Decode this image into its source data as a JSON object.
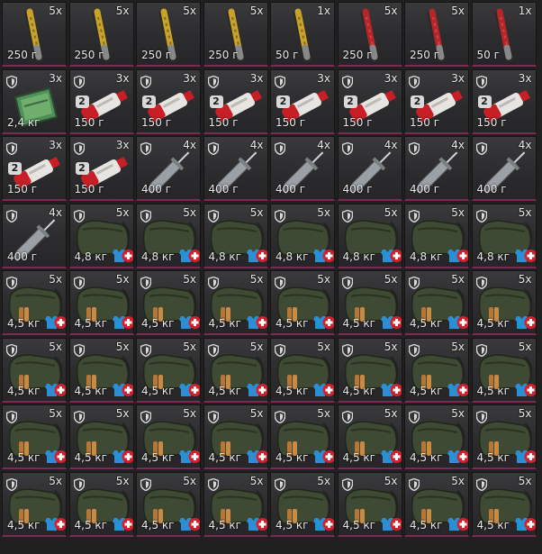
{
  "inventory": {
    "rows": [
      [
        {
          "item": "flare",
          "color": "yellow",
          "qty": "5x",
          "weight": "250 г"
        },
        {
          "item": "flare",
          "color": "yellow",
          "qty": "5x",
          "weight": "250 г"
        },
        {
          "item": "flare",
          "color": "yellow",
          "qty": "5x",
          "weight": "250 г"
        },
        {
          "item": "flare",
          "color": "yellow",
          "qty": "5x",
          "weight": "250 г"
        },
        {
          "item": "flare",
          "color": "yellow",
          "qty": "1x",
          "weight": "50 г"
        },
        {
          "item": "flare",
          "color": "red",
          "qty": "5x",
          "weight": "250 г"
        },
        {
          "item": "flare",
          "color": "red",
          "qty": "5x",
          "weight": "250 г"
        },
        {
          "item": "flare",
          "color": "red",
          "qty": "1x",
          "weight": "50 г"
        }
      ],
      [
        {
          "item": "map-pack",
          "qty": "3x",
          "weight": "2,4 кг",
          "shield": true
        },
        {
          "item": "ointment-tube",
          "qty": "3x",
          "weight": "150 г",
          "shield": true,
          "tier": "2"
        },
        {
          "item": "ointment-tube",
          "qty": "3x",
          "weight": "150 г",
          "shield": true,
          "tier": "2"
        },
        {
          "item": "ointment-tube",
          "qty": "3x",
          "weight": "150 г",
          "shield": true,
          "tier": "2"
        },
        {
          "item": "ointment-tube",
          "qty": "3x",
          "weight": "150 г",
          "shield": true,
          "tier": "2"
        },
        {
          "item": "ointment-tube",
          "qty": "3x",
          "weight": "150 г",
          "shield": true,
          "tier": "2"
        },
        {
          "item": "ointment-tube",
          "qty": "3x",
          "weight": "150 г",
          "shield": true,
          "tier": "2"
        },
        {
          "item": "ointment-tube",
          "qty": "3x",
          "weight": "150 г",
          "shield": true,
          "tier": "2"
        }
      ],
      [
        {
          "item": "ointment-tube",
          "qty": "3x",
          "weight": "150 г",
          "shield": true,
          "tier": "2"
        },
        {
          "item": "ointment-tube",
          "qty": "3x",
          "weight": "150 г",
          "shield": true,
          "tier": "2"
        },
        {
          "item": "syringe",
          "qty": "4x",
          "weight": "400 г",
          "shield": true
        },
        {
          "item": "syringe",
          "qty": "4x",
          "weight": "400 г",
          "shield": true
        },
        {
          "item": "syringe",
          "qty": "4x",
          "weight": "400 г",
          "shield": true
        },
        {
          "item": "syringe",
          "qty": "4x",
          "weight": "400 г",
          "shield": true
        },
        {
          "item": "syringe",
          "qty": "4x",
          "weight": "400 г",
          "shield": true
        },
        {
          "item": "syringe",
          "qty": "4x",
          "weight": "400 г",
          "shield": true
        }
      ],
      [
        {
          "item": "syringe",
          "qty": "4x",
          "weight": "400 г",
          "shield": true
        },
        {
          "item": "supply-bag",
          "qty": "5x",
          "weight": "4,8 кг",
          "shield": true
        },
        {
          "item": "supply-bag",
          "qty": "5x",
          "weight": "4,8 кг",
          "shield": true
        },
        {
          "item": "supply-bag",
          "qty": "5x",
          "weight": "4,8 кг",
          "shield": true
        },
        {
          "item": "supply-bag",
          "qty": "5x",
          "weight": "4,8 кг",
          "shield": true
        },
        {
          "item": "supply-bag",
          "qty": "5x",
          "weight": "4,8 кг",
          "shield": true
        },
        {
          "item": "supply-bag",
          "qty": "5x",
          "weight": "4,8 кг",
          "shield": true
        },
        {
          "item": "supply-bag",
          "qty": "5x",
          "weight": "4,8 кг",
          "shield": true
        }
      ],
      [
        {
          "item": "ammo-bag",
          "qty": "5x",
          "weight": "4,5 кг",
          "shield": true
        },
        {
          "item": "ammo-bag",
          "qty": "5x",
          "weight": "4,5 кг",
          "shield": true
        },
        {
          "item": "ammo-bag",
          "qty": "5x",
          "weight": "4,5 кг",
          "shield": true
        },
        {
          "item": "ammo-bag",
          "qty": "5x",
          "weight": "4,5 кг",
          "shield": true
        },
        {
          "item": "ammo-bag",
          "qty": "5x",
          "weight": "4,5 кг",
          "shield": true
        },
        {
          "item": "ammo-bag",
          "qty": "5x",
          "weight": "4,5 кг",
          "shield": true
        },
        {
          "item": "ammo-bag",
          "qty": "5x",
          "weight": "4,5 кг",
          "shield": true
        },
        {
          "item": "ammo-bag",
          "qty": "5x",
          "weight": "4,5 кг",
          "shield": true
        }
      ],
      [
        {
          "item": "ammo-bag",
          "qty": "5x",
          "weight": "4,5 кг",
          "shield": true
        },
        {
          "item": "ammo-bag",
          "qty": "5x",
          "weight": "4,5 кг",
          "shield": true
        },
        {
          "item": "ammo-bag",
          "qty": "5x",
          "weight": "4,5 кг",
          "shield": true
        },
        {
          "item": "ammo-bag",
          "qty": "5x",
          "weight": "4,5 кг",
          "shield": true
        },
        {
          "item": "ammo-bag",
          "qty": "5x",
          "weight": "4,5 кг",
          "shield": true
        },
        {
          "item": "ammo-bag",
          "qty": "5x",
          "weight": "4,5 кг",
          "shield": true
        },
        {
          "item": "ammo-bag",
          "qty": "5x",
          "weight": "4,5 кг",
          "shield": true
        },
        {
          "item": "ammo-bag",
          "qty": "5x",
          "weight": "4,5 кг",
          "shield": true
        }
      ],
      [
        {
          "item": "ammo-bag",
          "qty": "5x",
          "weight": "4,5 кг",
          "shield": true
        },
        {
          "item": "ammo-bag",
          "qty": "5x",
          "weight": "4,5 кг",
          "shield": true
        },
        {
          "item": "ammo-bag",
          "qty": "5x",
          "weight": "4,5 кг",
          "shield": true
        },
        {
          "item": "ammo-bag",
          "qty": "5x",
          "weight": "4,5 кг",
          "shield": true
        },
        {
          "item": "ammo-bag",
          "qty": "5x",
          "weight": "4,5 кг",
          "shield": true
        },
        {
          "item": "ammo-bag",
          "qty": "5x",
          "weight": "4,5 кг",
          "shield": true
        },
        {
          "item": "ammo-bag",
          "qty": "5x",
          "weight": "4,5 кг",
          "shield": true
        },
        {
          "item": "ammo-bag",
          "qty": "5x",
          "weight": "4,5 кг",
          "shield": true
        }
      ],
      [
        {
          "item": "ammo-bag",
          "qty": "5x",
          "weight": "4,5 кг",
          "shield": true
        },
        {
          "item": "ammo-bag",
          "qty": "5x",
          "weight": "4,5 кг",
          "shield": true
        },
        {
          "item": "ammo-bag",
          "qty": "5x",
          "weight": "4,5 кг",
          "shield": true
        },
        {
          "item": "ammo-bag",
          "qty": "5x",
          "weight": "4,5 кг",
          "shield": true
        },
        {
          "item": "ammo-bag",
          "qty": "5x",
          "weight": "4,5 кг",
          "shield": true
        },
        {
          "item": "ammo-bag",
          "qty": "5x",
          "weight": "4,5 кг",
          "shield": true
        },
        {
          "item": "ammo-bag",
          "qty": "5x",
          "weight": "4,5 кг",
          "shield": true
        },
        {
          "item": "ammo-bag",
          "qty": "5x",
          "weight": "4,5 кг",
          "shield": true
        }
      ]
    ]
  },
  "colors": {
    "yellow": "#c9a227",
    "red": "#b3262a",
    "bag": "#3f4a34",
    "badge_blue": "#2b8fd6",
    "badge_red": "#d2202c",
    "cell_accent": "#7a2a55"
  }
}
